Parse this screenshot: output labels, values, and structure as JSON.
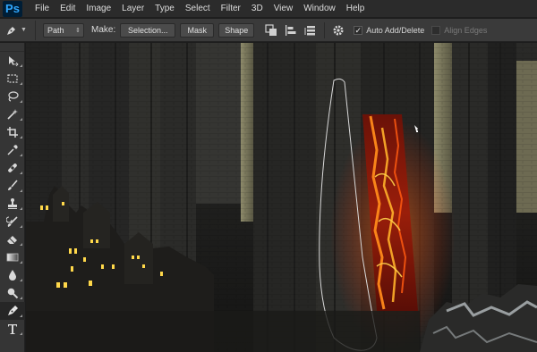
{
  "app": {
    "logo": "Ps"
  },
  "menu": {
    "items": [
      "File",
      "Edit",
      "Image",
      "Layer",
      "Type",
      "Select",
      "Filter",
      "3D",
      "View",
      "Window",
      "Help"
    ]
  },
  "options_bar": {
    "mode_value": "Path",
    "make_label": "Make:",
    "selection_label": "Selection...",
    "mask_label": "Mask",
    "shape_label": "Shape",
    "auto_add_delete_label": "Auto Add/Delete",
    "auto_add_delete_checked": true,
    "align_edges_label": "Align Edges",
    "align_edges_checked": false
  },
  "toolbar": {
    "tools": [
      {
        "name": "move-tool",
        "icon": "move-icon"
      },
      {
        "name": "marquee-tool",
        "icon": "marquee-icon"
      },
      {
        "name": "lasso-tool",
        "icon": "lasso-icon"
      },
      {
        "name": "quick-selection-tool",
        "icon": "wand-icon"
      },
      {
        "name": "crop-tool",
        "icon": "crop-icon"
      },
      {
        "name": "eyedropper-tool",
        "icon": "eyedropper-icon"
      },
      {
        "name": "healing-brush-tool",
        "icon": "bandage-icon"
      },
      {
        "name": "brush-tool",
        "icon": "brush-icon"
      },
      {
        "name": "clone-stamp-tool",
        "icon": "stamp-icon"
      },
      {
        "name": "history-brush-tool",
        "icon": "history-brush-icon"
      },
      {
        "name": "eraser-tool",
        "icon": "eraser-icon"
      },
      {
        "name": "gradient-tool",
        "icon": "gradient-icon"
      },
      {
        "name": "blur-tool",
        "icon": "drop-icon"
      },
      {
        "name": "dodge-tool",
        "icon": "dodge-icon"
      },
      {
        "name": "pen-tool",
        "icon": "pen-icon",
        "active": true
      },
      {
        "name": "type-tool",
        "icon": "type-icon"
      }
    ]
  },
  "colors": {
    "menubar": "#2b2b2b",
    "optionsbar": "#3a3a3a",
    "toolbar": "#353535",
    "accent_lava": "#ff6a1a",
    "window_glow": "#ffd84a"
  }
}
